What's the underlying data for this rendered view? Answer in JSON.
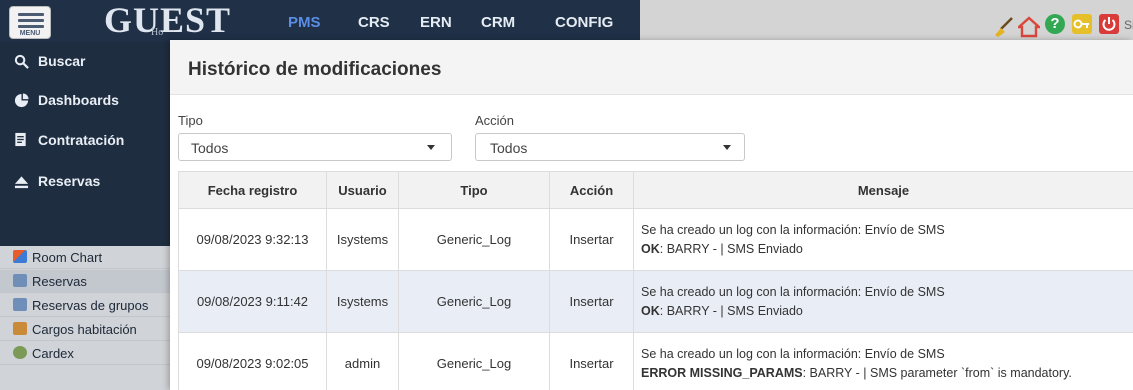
{
  "header": {
    "menu_label": "MENU",
    "logo": "GUEST",
    "logo_sub": "Ho",
    "nav": [
      {
        "label": "PMS",
        "active": true
      },
      {
        "label": "CRS"
      },
      {
        "label": "ERN"
      },
      {
        "label": "CRM"
      },
      {
        "label": "CONFIG"
      }
    ],
    "help_glyph": "?",
    "user_short": "Si"
  },
  "sidebar": {
    "main_items": [
      {
        "label": "Buscar",
        "icon": "search-icon"
      },
      {
        "label": "Dashboards",
        "icon": "pie-chart-icon"
      },
      {
        "label": "Contratación",
        "icon": "document-icon"
      },
      {
        "label": "Reservas",
        "icon": "eject-icon"
      }
    ],
    "sub_items": [
      {
        "label": "Room Chart",
        "icon": "room-chart-icon"
      },
      {
        "label": "Reservas",
        "icon": "reservation-icon",
        "active": true
      },
      {
        "label": "Reservas de grupos",
        "icon": "group-reservation-icon"
      },
      {
        "label": "Cargos habitación",
        "icon": "room-charges-icon"
      },
      {
        "label": "Cardex",
        "icon": "cardex-icon"
      }
    ]
  },
  "modal": {
    "title": "Histórico de modificaciones",
    "filters": {
      "tipo_label": "Tipo",
      "tipo_value": "Todos",
      "accion_label": "Acción",
      "accion_value": "Todos"
    },
    "table": {
      "columns": [
        "Fecha registro",
        "Usuario",
        "Tipo",
        "Acción",
        "Mensaje"
      ],
      "rows": [
        {
          "fecha": "09/08/2023 9:32:13",
          "usuario": "Isystems",
          "tipo": "Generic_Log",
          "accion": "Insertar",
          "msg_line1": "Se ha creado un log  con la información: Envío de SMS",
          "msg_status": "OK",
          "msg_rest": ": BARRY - | SMS Enviado"
        },
        {
          "fecha": "09/08/2023 9:11:42",
          "usuario": "Isystems",
          "tipo": "Generic_Log",
          "accion": "Insertar",
          "msg_line1": "Se ha creado un log  con la información: Envío de SMS",
          "msg_status": "OK",
          "msg_rest": ": BARRY - | SMS Enviado"
        },
        {
          "fecha": "09/08/2023 9:02:05",
          "usuario": "admin",
          "tipo": "Generic_Log",
          "accion": "Insertar",
          "msg_line1": "Se ha creado un log  con la información: Envío de SMS",
          "msg_status": "ERROR MISSING_PARAMS",
          "msg_rest": ": BARRY - | SMS parameter `from` is mandatory."
        }
      ]
    }
  },
  "colors": {
    "topbar": "#1f3047",
    "sidebar": "#1e2d40",
    "active_nav": "#5a8ee6",
    "alt_row": "#e9eef6"
  }
}
